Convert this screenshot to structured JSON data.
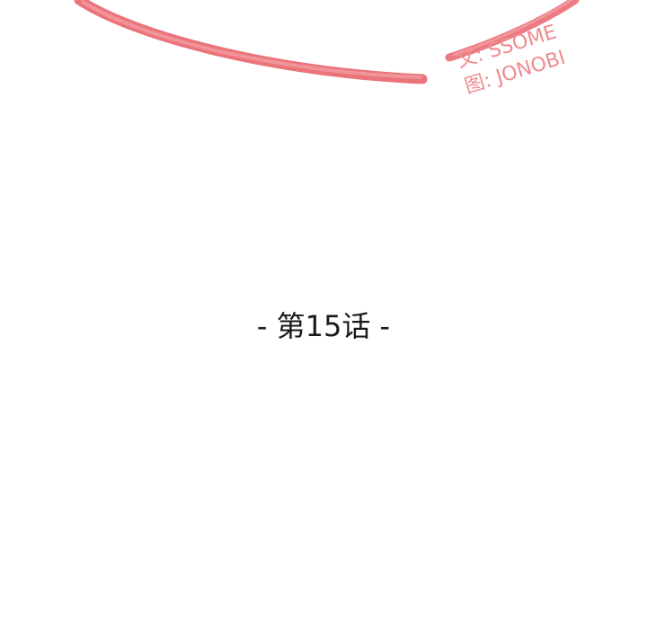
{
  "credits": {
    "writer": "文: SSOME",
    "artist": "图: JONOBI"
  },
  "chapter": {
    "title": "- 第15话 -"
  },
  "colors": {
    "accent": "#ea6b73",
    "credit_text": "#ef8a8e",
    "title_text": "#1a1a1a",
    "background": "#ffffff"
  },
  "decoration": {
    "brush_arc": "pink-brush-stroke"
  }
}
